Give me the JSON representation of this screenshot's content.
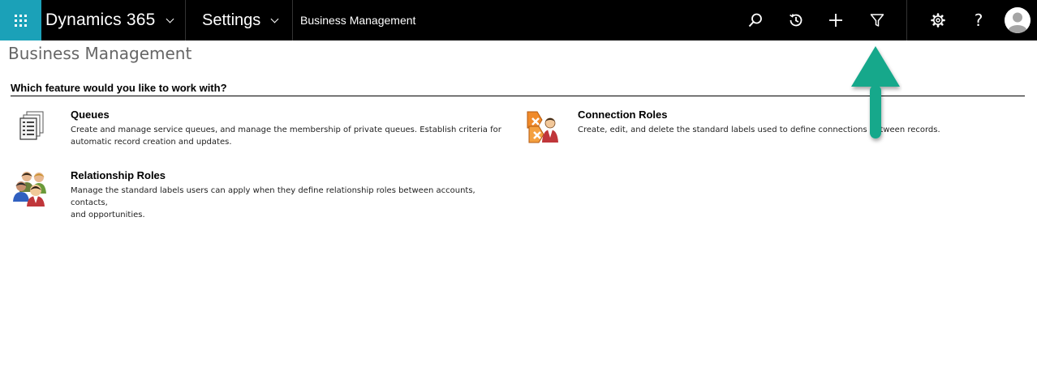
{
  "topbar": {
    "app_name": "Dynamics 365",
    "area_name": "Settings",
    "breadcrumb": "Business Management",
    "icons": [
      "apps-icon",
      "search-icon",
      "recent-icon",
      "plus-icon",
      "filter-icon",
      "gear-icon",
      "help-icon",
      "user-avatar"
    ],
    "help_glyph": "?"
  },
  "page": {
    "title": "Business Management",
    "section_heading": "Which feature would you like to work with?"
  },
  "features": [
    {
      "title": "Queues",
      "description_lines": [
        "Create and manage service queues, and manage the membership of private queues. Establish criteria for",
        "automatic record creation and updates."
      ],
      "icon": "queues-icon"
    },
    {
      "title": "Connection Roles",
      "description_lines": [
        "Create, edit, and delete the standard labels used to define connections between records."
      ],
      "icon": "connection-roles-icon"
    },
    {
      "title": "Relationship Roles",
      "description_lines": [
        "Manage the standard labels users can apply when they define relationship roles between accounts, contacts,",
        "and opportunities."
      ],
      "icon": "relationship-roles-icon"
    }
  ],
  "colors": {
    "topbar_bg": "#000000",
    "waffle_bg": "#1ba1b8",
    "callout_arrow": "#13a88b",
    "page_title": "#666666"
  }
}
